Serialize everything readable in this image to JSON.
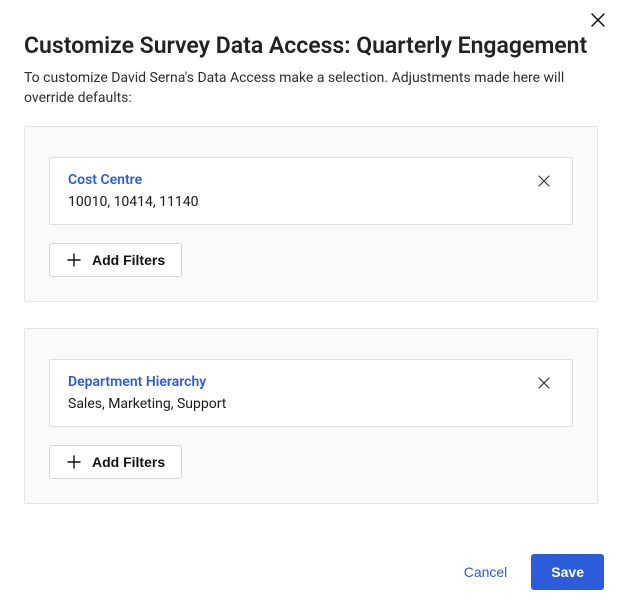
{
  "dialog": {
    "title": "Customize Survey Data Access: Quarterly Engagement",
    "subtitle": "To customize David Serna's Data Access make a selection. Adjustments made here will override defaults:"
  },
  "sections": [
    {
      "filter_label": "Cost Centre",
      "filter_values": "10010, 10414, 11140",
      "add_button_label": "Add Filters"
    },
    {
      "filter_label": "Department Hierarchy",
      "filter_values": "Sales, Marketing, Support",
      "add_button_label": "Add Filters"
    }
  ],
  "footer": {
    "cancel_label": "Cancel",
    "save_label": "Save"
  }
}
